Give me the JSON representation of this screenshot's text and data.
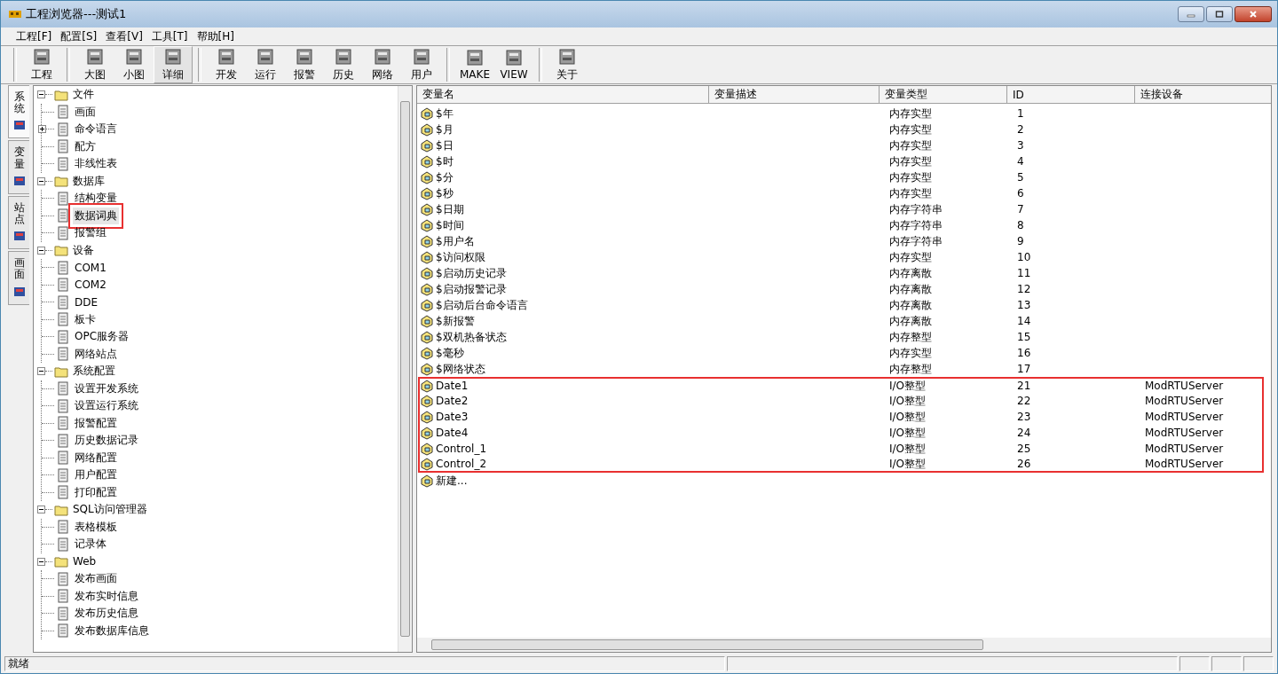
{
  "window": {
    "title": "工程浏览器---测试1"
  },
  "menu": [
    "工程[F]",
    "配置[S]",
    "查看[V]",
    "工具[T]",
    "帮助[H]"
  ],
  "toolbar": [
    [
      {
        "label": "工程",
        "selected": false
      }
    ],
    [
      {
        "label": "大图",
        "selected": false
      },
      {
        "label": "小图",
        "selected": false
      },
      {
        "label": "详细",
        "selected": true
      }
    ],
    [
      {
        "label": "开发",
        "selected": false
      },
      {
        "label": "运行",
        "selected": false
      },
      {
        "label": "报警",
        "selected": false
      },
      {
        "label": "历史",
        "selected": false
      },
      {
        "label": "网络",
        "selected": false
      },
      {
        "label": "用户",
        "selected": false
      }
    ],
    [
      {
        "label": "MAKE",
        "selected": false
      },
      {
        "label": "VIEW",
        "selected": false
      }
    ],
    [
      {
        "label": "关于",
        "selected": false
      }
    ]
  ],
  "side_tabs": [
    {
      "label": "系统",
      "selected": true
    },
    {
      "label": "变量",
      "selected": false
    },
    {
      "label": "站点",
      "selected": false
    },
    {
      "label": "画面",
      "selected": false
    }
  ],
  "tree": [
    {
      "label": "文件",
      "expanded": true,
      "children": [
        {
          "label": "画面"
        },
        {
          "label": "命令语言",
          "expanded": false
        },
        {
          "label": "配方"
        },
        {
          "label": "非线性表"
        }
      ]
    },
    {
      "label": "数据库",
      "expanded": true,
      "children": [
        {
          "label": "结构变量"
        },
        {
          "label": "数据词典",
          "selected": true
        },
        {
          "label": "报警组"
        }
      ]
    },
    {
      "label": "设备",
      "expanded": true,
      "children": [
        {
          "label": "COM1"
        },
        {
          "label": "COM2"
        },
        {
          "label": "DDE"
        },
        {
          "label": "板卡"
        },
        {
          "label": "OPC服务器"
        },
        {
          "label": "网络站点"
        }
      ]
    },
    {
      "label": "系统配置",
      "expanded": true,
      "children": [
        {
          "label": "设置开发系统"
        },
        {
          "label": "设置运行系统"
        },
        {
          "label": "报警配置"
        },
        {
          "label": "历史数据记录"
        },
        {
          "label": "网络配置"
        },
        {
          "label": "用户配置"
        },
        {
          "label": "打印配置"
        }
      ]
    },
    {
      "label": "SQL访问管理器",
      "expanded": true,
      "children": [
        {
          "label": "表格模板"
        },
        {
          "label": "记录体"
        }
      ]
    },
    {
      "label": "Web",
      "expanded": true,
      "children": [
        {
          "label": "发布画面"
        },
        {
          "label": "发布实时信息"
        },
        {
          "label": "发布历史信息"
        },
        {
          "label": "发布数据库信息"
        }
      ]
    }
  ],
  "table": {
    "columns": [
      "变量名",
      "变量描述",
      "变量类型",
      "ID",
      "连接设备"
    ],
    "rows": [
      {
        "name": "$年",
        "type": "内存实型",
        "id": "1",
        "marked": false
      },
      {
        "name": "$月",
        "type": "内存实型",
        "id": "2",
        "marked": false
      },
      {
        "name": "$日",
        "type": "内存实型",
        "id": "3",
        "marked": false
      },
      {
        "name": "$时",
        "type": "内存实型",
        "id": "4",
        "marked": false
      },
      {
        "name": "$分",
        "type": "内存实型",
        "id": "5",
        "marked": false
      },
      {
        "name": "$秒",
        "type": "内存实型",
        "id": "6",
        "marked": false
      },
      {
        "name": "$日期",
        "type": "内存字符串",
        "id": "7",
        "marked": false
      },
      {
        "name": "$时间",
        "type": "内存字符串",
        "id": "8",
        "marked": false
      },
      {
        "name": "$用户名",
        "type": "内存字符串",
        "id": "9",
        "marked": false
      },
      {
        "name": "$访问权限",
        "type": "内存实型",
        "id": "10",
        "marked": false
      },
      {
        "name": "$启动历史记录",
        "type": "内存离散",
        "id": "11",
        "marked": false
      },
      {
        "name": "$启动报警记录",
        "type": "内存离散",
        "id": "12",
        "marked": false
      },
      {
        "name": "$启动后台命令语言",
        "type": "内存离散",
        "id": "13",
        "marked": false
      },
      {
        "name": "$新报警",
        "type": "内存离散",
        "id": "14",
        "marked": false
      },
      {
        "name": "$双机热备状态",
        "type": "内存整型",
        "id": "15",
        "marked": false
      },
      {
        "name": "$毫秒",
        "type": "内存实型",
        "id": "16",
        "marked": false
      },
      {
        "name": "$网络状态",
        "type": "内存整型",
        "id": "17",
        "marked": false
      },
      {
        "name": "Date1",
        "type": "I/O整型",
        "id": "21",
        "device": "ModRTUServer",
        "marked": true
      },
      {
        "name": "Date2",
        "type": "I/O整型",
        "id": "22",
        "device": "ModRTUServer",
        "marked": true
      },
      {
        "name": "Date3",
        "type": "I/O整型",
        "id": "23",
        "device": "ModRTUServer",
        "marked": true
      },
      {
        "name": "Date4",
        "type": "I/O整型",
        "id": "24",
        "device": "ModRTUServer",
        "marked": true
      },
      {
        "name": "Control_1",
        "type": "I/O整型",
        "id": "25",
        "device": "ModRTUServer",
        "marked": true
      },
      {
        "name": "Control_2",
        "type": "I/O整型",
        "id": "26",
        "device": "ModRTUServer",
        "marked": true
      }
    ],
    "new_item": "新建..."
  },
  "status_bar": {
    "text": "就绪"
  }
}
